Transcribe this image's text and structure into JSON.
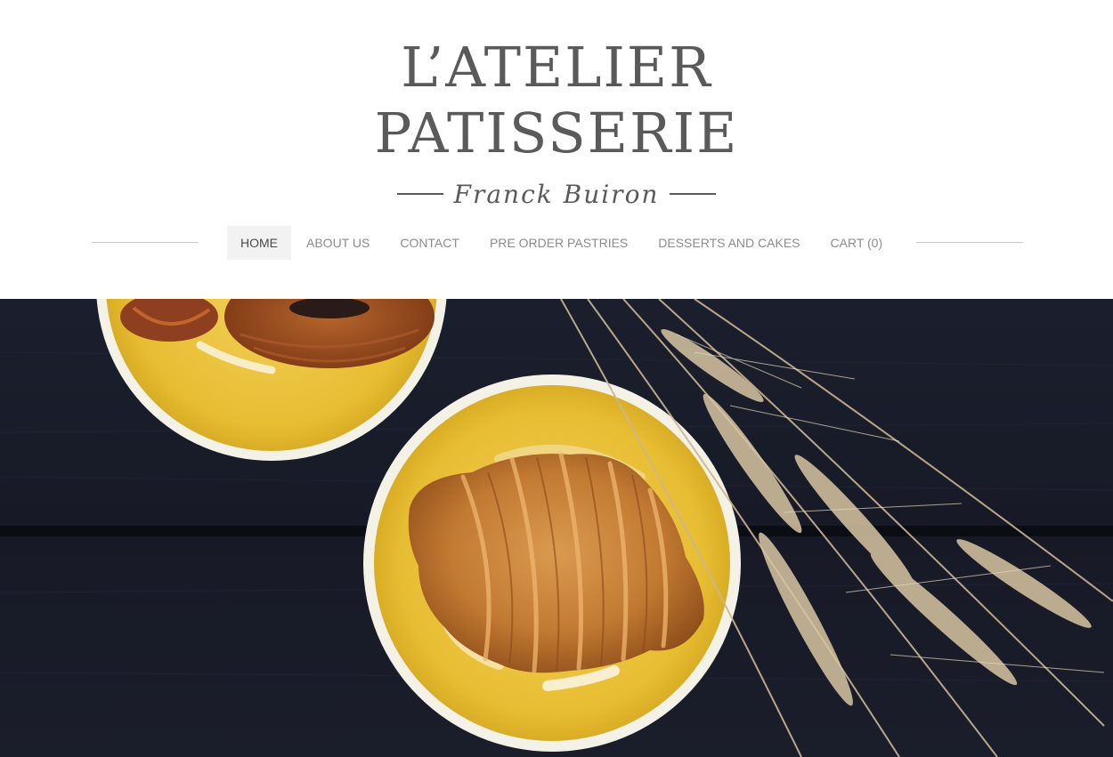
{
  "logo": {
    "line1": "L’ATELIER",
    "line2": "PATISSERIE",
    "subtitle": "Franck Buiron"
  },
  "nav": {
    "items": [
      {
        "label": "HOME",
        "active": true
      },
      {
        "label": "ABOUT US"
      },
      {
        "label": "CONTACT"
      },
      {
        "label": "PRE ORDER PASTRIES"
      },
      {
        "label": "DESSERTS AND CAKES"
      },
      {
        "label": "CART (0)"
      }
    ]
  },
  "colors": {
    "text": "#5a5a5a",
    "nav_text": "#8c8c8c",
    "nav_active_bg": "#f2f2f2",
    "plate_yellow": "#e9c23d",
    "table_dark": "#181b28"
  },
  "hero": {
    "icon": "croissant-photo"
  }
}
